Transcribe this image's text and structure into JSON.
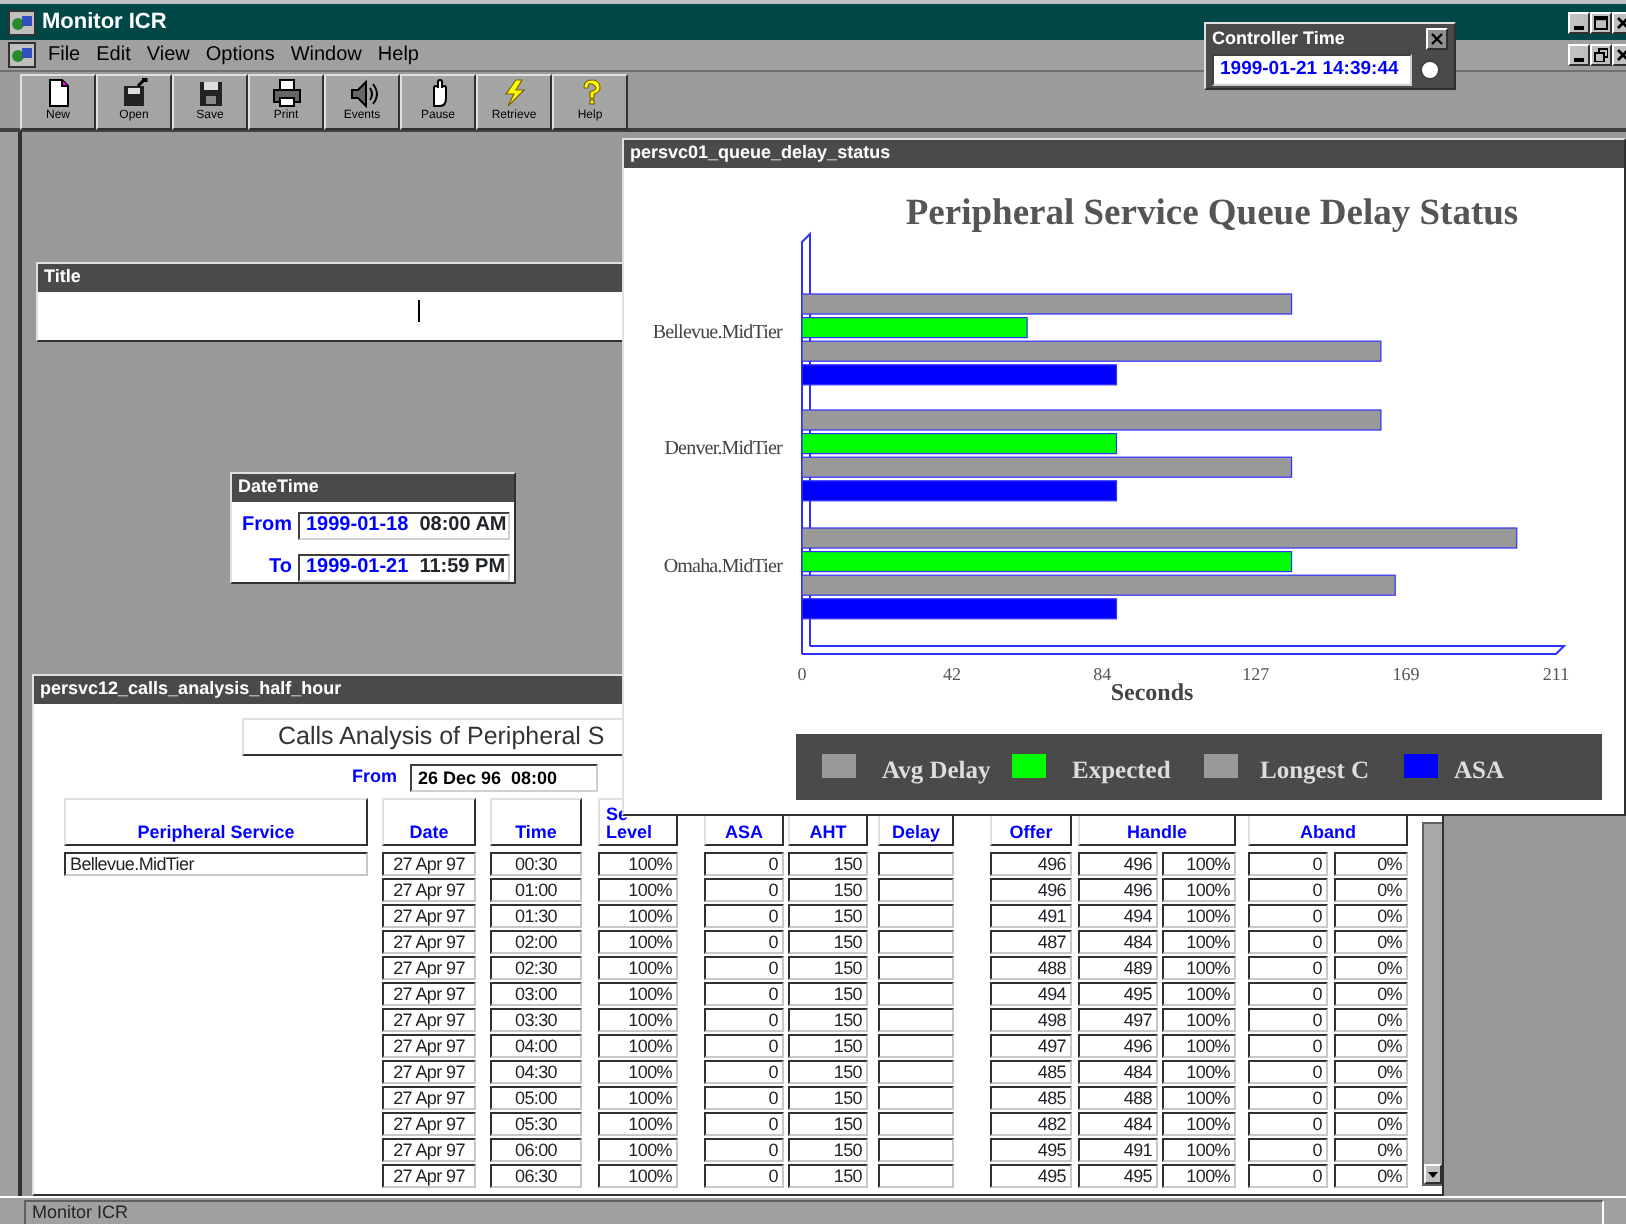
{
  "window": {
    "title": "Monitor ICR"
  },
  "menu": [
    "File",
    "Edit",
    "View",
    "Options",
    "Window",
    "Help"
  ],
  "toolbar": [
    {
      "label": "New",
      "kind": "new"
    },
    {
      "label": "Open",
      "kind": "open"
    },
    {
      "label": "Save",
      "kind": "save"
    },
    {
      "label": "Print",
      "kind": "print"
    },
    {
      "label": "Events",
      "kind": "events"
    },
    {
      "label": "Pause",
      "kind": "pause"
    },
    {
      "label": "Retrieve",
      "kind": "retrieve"
    },
    {
      "label": "Help",
      "kind": "help"
    }
  ],
  "controller_time": {
    "title": "Controller Time",
    "value": "1999-01-21 14:39:44",
    "radio_selected": false
  },
  "title_window": {
    "title": "Title"
  },
  "datetime_window": {
    "title": "DateTime",
    "rows": [
      {
        "label": "From",
        "date": "1999-01-18",
        "time": "08:00 AM"
      },
      {
        "label": "To",
        "date": "1999-01-21",
        "time": "11:59 PM"
      }
    ]
  },
  "chart_window": {
    "title": "persvc01_queue_delay_status",
    "chart_data": {
      "type": "bar",
      "orientation": "horizontal",
      "title": "Peripheral Service Queue Delay Status",
      "xlabel": "Seconds",
      "categories": [
        "Bellevue.MidTier",
        "Denver.MidTier",
        "Omaha.MidTier"
      ],
      "xlim": [
        0,
        211
      ],
      "xticks": [
        0,
        42,
        84,
        127,
        169,
        211
      ],
      "legend": "bottom",
      "series": [
        {
          "name": "Avg Delay",
          "color": "#999999",
          "values": [
            137,
            162,
            200
          ]
        },
        {
          "name": "Expected",
          "color": "#00ff00",
          "values": [
            63,
            88,
            137
          ]
        },
        {
          "name": "Longest C",
          "color": "#999999",
          "values": [
            162,
            137,
            166
          ]
        },
        {
          "name": "ASA",
          "color": "#0000ff",
          "values": [
            88,
            88,
            88
          ]
        }
      ]
    }
  },
  "calls_window": {
    "title": "persvc12_calls_analysis_half_hour",
    "heading": "Calls Analysis of Peripheral S",
    "from_label": "From",
    "from_value": "26 Dec 96  08:00",
    "columns": [
      {
        "lines": [
          "Peripheral Service"
        ],
        "kind": "single"
      },
      {
        "lines": [
          "Date"
        ],
        "kind": "single"
      },
      {
        "lines": [
          "Time"
        ],
        "kind": "single"
      },
      {
        "lines": [
          "Se",
          "Level"
        ],
        "kind": "single"
      },
      {
        "lines": [
          "ASA"
        ],
        "kind": "single"
      },
      {
        "lines": [
          "AHT"
        ],
        "kind": "single"
      },
      {
        "lines": [
          "Delay"
        ],
        "kind": "single"
      },
      {
        "lines": [
          "Offer"
        ],
        "kind": "single"
      },
      {
        "lines": [
          "Handle"
        ],
        "kind": "pair"
      },
      {
        "lines": [
          "Aband"
        ],
        "kind": "pair"
      }
    ],
    "rows": [
      {
        "peripheral_service": "Bellevue.MidTier",
        "date": "27 Apr 97",
        "time": "00:30",
        "service_level": "100%",
        "asa": "0",
        "aht": "150",
        "offer": "496",
        "handled": "496",
        "handled_pct": "100%",
        "abandoned": "0",
        "abandoned_pct": "0%"
      },
      {
        "date": "27 Apr 97",
        "time": "01:00",
        "service_level": "100%",
        "asa": "0",
        "aht": "150",
        "offer": "496",
        "handled": "496",
        "handled_pct": "100%",
        "abandoned": "0",
        "abandoned_pct": "0%"
      },
      {
        "date": "27 Apr 97",
        "time": "01:30",
        "service_level": "100%",
        "asa": "0",
        "aht": "150",
        "offer": "491",
        "handled": "494",
        "handled_pct": "100%",
        "abandoned": "0",
        "abandoned_pct": "0%"
      },
      {
        "date": "27 Apr 97",
        "time": "02:00",
        "service_level": "100%",
        "asa": "0",
        "aht": "150",
        "offer": "487",
        "handled": "484",
        "handled_pct": "100%",
        "abandoned": "0",
        "abandoned_pct": "0%"
      },
      {
        "date": "27 Apr 97",
        "time": "02:30",
        "service_level": "100%",
        "asa": "0",
        "aht": "150",
        "offer": "488",
        "handled": "489",
        "handled_pct": "100%",
        "abandoned": "0",
        "abandoned_pct": "0%"
      },
      {
        "date": "27 Apr 97",
        "time": "03:00",
        "service_level": "100%",
        "asa": "0",
        "aht": "150",
        "offer": "494",
        "handled": "495",
        "handled_pct": "100%",
        "abandoned": "0",
        "abandoned_pct": "0%"
      },
      {
        "date": "27 Apr 97",
        "time": "03:30",
        "service_level": "100%",
        "asa": "0",
        "aht": "150",
        "offer": "498",
        "handled": "497",
        "handled_pct": "100%",
        "abandoned": "0",
        "abandoned_pct": "0%"
      },
      {
        "date": "27 Apr 97",
        "time": "04:00",
        "service_level": "100%",
        "asa": "0",
        "aht": "150",
        "offer": "497",
        "handled": "496",
        "handled_pct": "100%",
        "abandoned": "0",
        "abandoned_pct": "0%"
      },
      {
        "date": "27 Apr 97",
        "time": "04:30",
        "service_level": "100%",
        "asa": "0",
        "aht": "150",
        "offer": "485",
        "handled": "484",
        "handled_pct": "100%",
        "abandoned": "0",
        "abandoned_pct": "0%"
      },
      {
        "date": "27 Apr 97",
        "time": "05:00",
        "service_level": "100%",
        "asa": "0",
        "aht": "150",
        "offer": "485",
        "handled": "488",
        "handled_pct": "100%",
        "abandoned": "0",
        "abandoned_pct": "0%"
      },
      {
        "date": "27 Apr 97",
        "time": "05:30",
        "service_level": "100%",
        "asa": "0",
        "aht": "150",
        "offer": "482",
        "handled": "484",
        "handled_pct": "100%",
        "abandoned": "0",
        "abandoned_pct": "0%"
      },
      {
        "date": "27 Apr 97",
        "time": "06:00",
        "service_level": "100%",
        "asa": "0",
        "aht": "150",
        "offer": "495",
        "handled": "491",
        "handled_pct": "100%",
        "abandoned": "0",
        "abandoned_pct": "0%"
      },
      {
        "date": "27 Apr 97",
        "time": "06:30",
        "service_level": "100%",
        "asa": "0",
        "aht": "150",
        "offer": "495",
        "handled": "495",
        "handled_pct": "100%",
        "abandoned": "0",
        "abandoned_pct": "0%"
      }
    ]
  },
  "status_bar": "Monitor ICR"
}
